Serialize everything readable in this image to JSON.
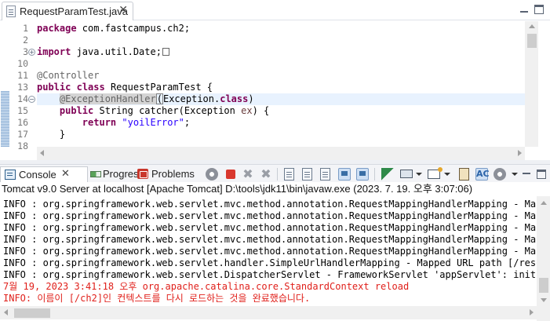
{
  "editor": {
    "tab_label": "RequestParamTest.java",
    "close_glyph": "✕",
    "lines": [
      {
        "num": "1",
        "segments": [
          {
            "t": "package",
            "c": "kw"
          },
          {
            "t": " com.fastcampus.ch2;",
            "c": "pl"
          }
        ]
      },
      {
        "num": "2",
        "segments": []
      },
      {
        "num": "3",
        "fold": "+",
        "segments": [
          {
            "t": "import",
            "c": "kw"
          },
          {
            "t": " java.util.Date;",
            "c": "pl"
          }
        ],
        "collapsed": true
      },
      {
        "num": "10",
        "segments": []
      },
      {
        "num": "11",
        "segments": [
          {
            "t": "@Controller",
            "c": "ann"
          }
        ]
      },
      {
        "num": "13",
        "segments": [
          {
            "t": "public",
            "c": "kw"
          },
          {
            "t": " ",
            "c": "pl"
          },
          {
            "t": "class",
            "c": "kw"
          },
          {
            "t": " RequestParamTest {",
            "c": "pl"
          }
        ]
      },
      {
        "num": "14",
        "fold": "−",
        "current": true,
        "segments": [
          {
            "t": "    ",
            "c": "pl"
          },
          {
            "t": "@ExceptionHandler",
            "c": "ann-hl"
          },
          {
            "t": "(",
            "c": "match"
          },
          {
            "t": "Exception.",
            "c": "pl"
          },
          {
            "t": "class",
            "c": "kw"
          },
          {
            "t": ")",
            "c": "pl"
          }
        ]
      },
      {
        "num": "15",
        "segments": [
          {
            "t": "    ",
            "c": "pl"
          },
          {
            "t": "public",
            "c": "kw"
          },
          {
            "t": " String catcher(Exception ",
            "c": "pl"
          },
          {
            "t": "ex",
            "c": "param"
          },
          {
            "t": ") {",
            "c": "pl"
          }
        ]
      },
      {
        "num": "16",
        "segments": [
          {
            "t": "        ",
            "c": "pl"
          },
          {
            "t": "return",
            "c": "kw"
          },
          {
            "t": " ",
            "c": "pl"
          },
          {
            "t": "\"yoilError\"",
            "c": "str"
          },
          {
            "t": ";",
            "c": "pl"
          }
        ]
      },
      {
        "num": "17",
        "segments": [
          {
            "t": "    }",
            "c": "pl"
          }
        ]
      },
      {
        "num": "18",
        "segments": []
      }
    ]
  },
  "console_view": {
    "tabs": [
      {
        "label": "Console",
        "icon": "console-icon",
        "active": true
      },
      {
        "label": "Progress",
        "icon": "progress-icon"
      },
      {
        "label": "Problems",
        "icon": "problems-icon"
      }
    ],
    "toolbar_icons": [
      "gear-icon",
      "terminate-icon",
      "remove-launch-icon",
      "remove-all-launches-icon",
      "clear-console-icon",
      "scroll-lock-icon",
      "word-wrap-icon",
      "show-on-stdout-icon",
      "show-on-stderr-icon",
      "pin-console-icon",
      "display-console-icon",
      "open-console-icon",
      "copy-icon",
      "ac-icon",
      "settings-icon"
    ],
    "title": "Tomcat v9.0 Server at localhost [Apache Tomcat] D:\\tools\\jdk11\\bin\\javaw.exe  (2023. 7. 19. 오후 3:07:06)",
    "output_lines": [
      {
        "text": "INFO : org.springframework.web.servlet.mvc.method.annotation.RequestMappingHandlerMapping - Mapped",
        "err": false
      },
      {
        "text": "INFO : org.springframework.web.servlet.mvc.method.annotation.RequestMappingHandlerMapping - Mappe",
        "err": false
      },
      {
        "text": "INFO : org.springframework.web.servlet.mvc.method.annotation.RequestMappingHandlerMapping - Mappe",
        "err": false
      },
      {
        "text": "INFO : org.springframework.web.servlet.mvc.method.annotation.RequestMappingHandlerMapping - Mappe",
        "err": false
      },
      {
        "text": "INFO : org.springframework.web.servlet.mvc.method.annotation.RequestMappingHandlerMapping - Mappe",
        "err": false
      },
      {
        "text": "INFO : org.springframework.web.servlet.handler.SimpleUrlHandlerMapping - Mapped URL path [/resour",
        "err": false
      },
      {
        "text": "INFO : org.springframework.web.servlet.DispatcherServlet - FrameworkServlet 'appServlet': initial",
        "err": false
      },
      {
        "text": "7월 19, 2023 3:41:18 오후 org.apache.catalina.core.StandardContext reload",
        "err": true
      },
      {
        "text": "INFO: 이름이 [/ch2]인 컨텍스트를 다시 로드하는 것을 완료했습니다.",
        "err": true
      }
    ]
  },
  "colors": {
    "keyword": "#7f0055",
    "annotation": "#646464",
    "string": "#2a00ff",
    "error_text": "#e0201b",
    "current_line": "#e8f2fe"
  }
}
